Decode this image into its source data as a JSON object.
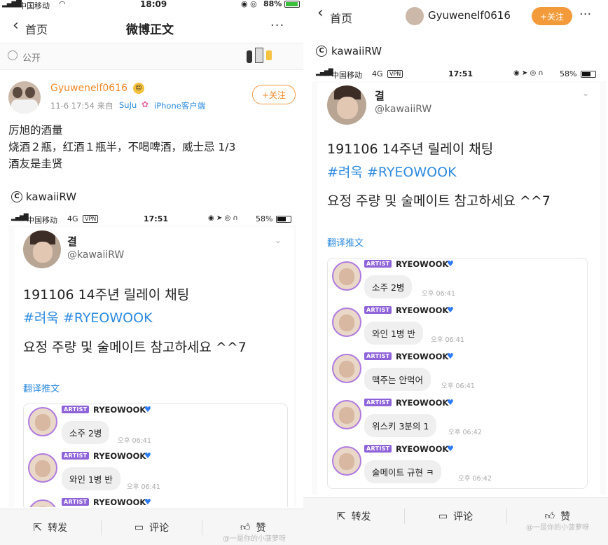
{
  "left": {
    "status": {
      "carrier": "中国移动",
      "time": "18:09",
      "battery": "88%"
    },
    "nav": {
      "back": "首页",
      "title": "微博正文",
      "more": "···"
    },
    "visibility": "公开",
    "post": {
      "author": "Gyuwenelf0616",
      "meta": "11-6 17:54  来自",
      "source": "SuJu",
      "device": "iPhone客户端",
      "follow": "+关注",
      "lines": [
        "厉旭的酒量",
        "烧酒２瓶，红酒１瓶半，不喝啤酒，威士忌 1/3",
        "酒友是圭贤"
      ]
    },
    "quote_source": "kawaiiRW",
    "inner_status": {
      "carrier": "中国移动",
      "net": "4G",
      "vpn": "VPN",
      "time": "17:51",
      "battery": "58%"
    },
    "tweet": {
      "name": "결",
      "handle": "@kawaiiRW",
      "line1": "191106 14주년 릴레이 채팅",
      "hashtags": "#려욱 #RYEOWOOK",
      "line3": "요정 주량 및 술메이트 참고하세요 ^^7",
      "translate": "翻译推文"
    },
    "chat": [
      {
        "badge": "ARTIST",
        "name": "RYEOWOOK",
        "msg": "소주 2병",
        "time": "오후 06:41"
      },
      {
        "badge": "ARTIST",
        "name": "RYEOWOOK",
        "msg": "와인 1병 반",
        "time": "오후 06:41"
      },
      {
        "badge": "ARTIST",
        "name": "RYEOWOOK"
      }
    ],
    "bottom": {
      "repost": "转发",
      "comment": "评论",
      "like": "赞"
    },
    "watermark": "@一是你的小菠萝呀"
  },
  "right": {
    "nav": {
      "back": "首页",
      "user": "Gyuwenelf0616",
      "follow": "+关注",
      "more": "···"
    },
    "quote_source": "kawaiiRW",
    "inner_status": {
      "carrier": "中国移动",
      "net": "4G",
      "vpn": "VPN",
      "time": "17:51",
      "battery": "58%"
    },
    "tweet": {
      "name": "결",
      "handle": "@kawaiiRW",
      "line1": "191106 14주년 릴레이 채팅",
      "hashtags": "#려욱 #RYEOWOOK",
      "line3": "요정 주량 및 술메이트 참고하세요 ^^7",
      "translate": "翻译推文"
    },
    "chat": [
      {
        "badge": "ARTIST",
        "name": "RYEOWOOK",
        "msg": "소주 2병",
        "time": "오후 06:41"
      },
      {
        "badge": "ARTIST",
        "name": "RYEOWOOK",
        "msg": "와인 1병 반",
        "time": "오후 06:41"
      },
      {
        "badge": "ARTIST",
        "name": "RYEOWOOK",
        "msg": "맥주는 안먹어",
        "time": "오후 06:41"
      },
      {
        "badge": "ARTIST",
        "name": "RYEOWOOK",
        "msg": "위스키 3분의 1",
        "time": "오후 06:42"
      },
      {
        "badge": "ARTIST",
        "name": "RYEOWOOK",
        "msg": "술메이트  규현 ㅋ",
        "time": "오후 06:42"
      }
    ],
    "bottom": {
      "repost": "转发",
      "comment": "评论",
      "like": "赞"
    },
    "watermark": "@一是你的小菠萝呀"
  },
  "colors": {
    "accent": "#f28a2a",
    "link": "#2e8be0",
    "artist": "#8e62d9",
    "heart": "#2e7bf5"
  }
}
